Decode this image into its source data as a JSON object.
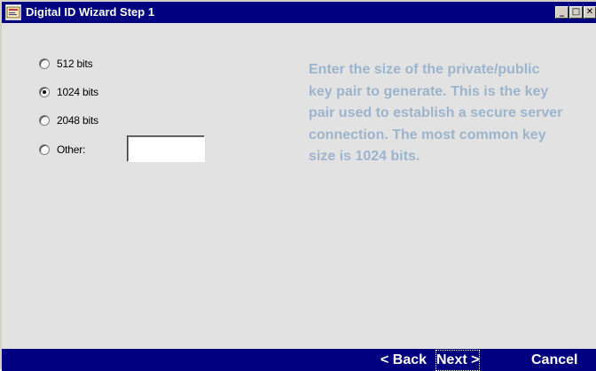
{
  "window": {
    "title": "Digital ID Wizard Step 1",
    "icon": "app-icon",
    "controls": {
      "minimize": "_",
      "maximize": "□",
      "close": "✕"
    }
  },
  "options": [
    {
      "label": "512 bits",
      "checked": false
    },
    {
      "label": "1024 bits",
      "checked": true
    },
    {
      "label": "2048 bits",
      "checked": false
    },
    {
      "label": "Other:",
      "checked": false
    }
  ],
  "other_input": {
    "value": ""
  },
  "help_text": "Enter the size of the private/public key pair to generate. This is the key pair used to establish a secure server connection. The most common key size is 1024 bits.",
  "footer": {
    "back_label": "< Back",
    "next_label": "Next >",
    "cancel_label": "Cancel"
  },
  "colors": {
    "title_bar": "#000080",
    "help_text": "#9cb4cc",
    "background": "#e2e2e2"
  }
}
